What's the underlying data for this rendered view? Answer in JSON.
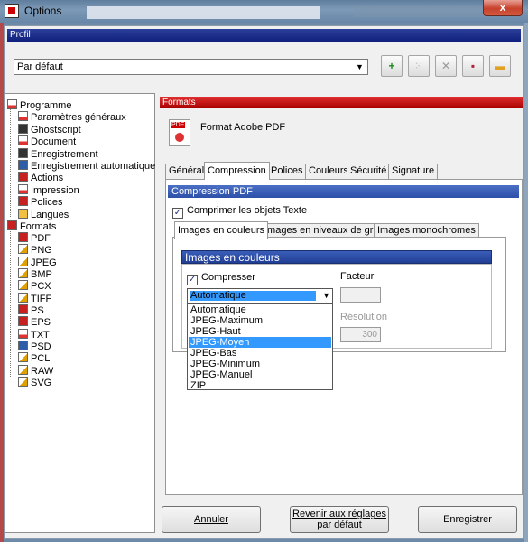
{
  "window": {
    "title": "Options",
    "close_label": "x"
  },
  "profile": {
    "header": "Profil",
    "selected": "Par défaut",
    "toolbar": [
      {
        "name": "add-profile-icon",
        "glyph": "+"
      },
      {
        "name": "copy-profile-icon",
        "glyph": "⁙"
      },
      {
        "name": "delete-profile-icon",
        "glyph": "✕"
      },
      {
        "name": "save-profile-icon",
        "glyph": "▪"
      },
      {
        "name": "open-profile-icon",
        "glyph": "▭"
      }
    ]
  },
  "tree": {
    "programme": "Programme",
    "programme_items": [
      "Paramètres généraux",
      "Ghostscript",
      "Document",
      "Enregistrement",
      "Enregistrement automatique",
      "Actions",
      "Impression",
      "Polices",
      "Langues"
    ],
    "formats": "Formats",
    "format_items": [
      "PDF",
      "PNG",
      "JPEG",
      "BMP",
      "PCX",
      "TIFF",
      "PS",
      "EPS",
      "TXT",
      "PSD",
      "PCL",
      "RAW",
      "SVG"
    ]
  },
  "formats_panel": {
    "header": "Formats",
    "icon_label": "PDF",
    "format_title": "Format Adobe PDF",
    "tabs": [
      "Général",
      "Compression",
      "Polices",
      "Couleurs",
      "Sécurité",
      "Signature"
    ],
    "active_tab": "Compression"
  },
  "compression": {
    "header": "Compression PDF",
    "compress_text_label": "Comprimer les objets Texte",
    "compress_text_checked": true,
    "subtabs": [
      "Images en couleurs",
      "Images en niveaux de gris",
      "Images monochromes"
    ],
    "images": {
      "header": "Images en couleurs",
      "compress_label": "Compresser",
      "compress_checked": true,
      "factor_label": "Facteur",
      "factor_value": "",
      "resolution_label": "Résolution",
      "resolution_value": "300",
      "method_selected": "Automatique",
      "method_options": [
        "Automatique",
        "JPEG-Maximum",
        "JPEG-Haut",
        "JPEG-Moyen",
        "JPEG-Bas",
        "JPEG-Minimum",
        "JPEG-Manuel",
        "ZIP"
      ],
      "highlighted_option": "JPEG-Moyen"
    }
  },
  "buttons": {
    "cancel": "Annuler",
    "reset_line1": "Revenir aux réglages",
    "reset_line2": "par défaut",
    "save": "Enregistrer"
  },
  "colors": {
    "profile_bar": "#0f1f7d",
    "formats_bar": "#c00000",
    "selection": "#3399ff"
  }
}
